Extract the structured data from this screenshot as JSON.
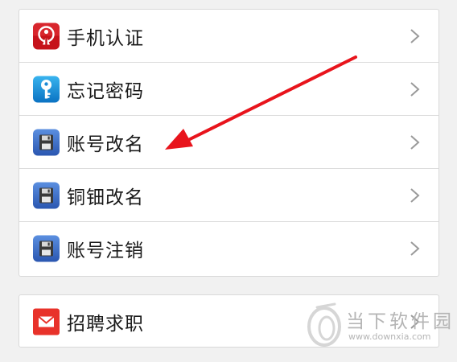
{
  "settings": {
    "group1": [
      {
        "id": "phone-auth",
        "label": "手机认证",
        "icon": "phone-auth-icon"
      },
      {
        "id": "forgot-password",
        "label": "忘记密码",
        "icon": "key-icon"
      },
      {
        "id": "account-rename",
        "label": "账号改名",
        "icon": "floppy-disk-icon"
      },
      {
        "id": "bronze-rename",
        "label": "铜钿改名",
        "icon": "floppy-disk-icon"
      },
      {
        "id": "account-cancel",
        "label": "账号注销",
        "icon": "floppy-disk-icon"
      }
    ],
    "group2": [
      {
        "id": "job-recruit",
        "label": "招聘求职",
        "icon": "envelope-icon"
      }
    ]
  },
  "annotation": {
    "arrow_color": "#e8141c",
    "points_to": "account-rename"
  },
  "watermark": {
    "name": "当下软件园",
    "url": "www.downxia.com"
  }
}
